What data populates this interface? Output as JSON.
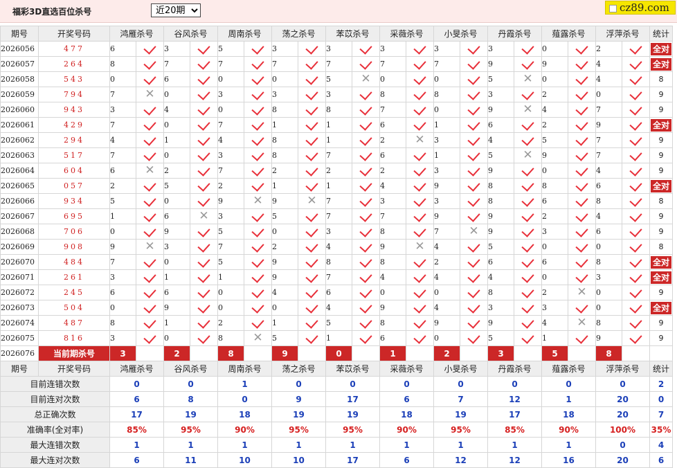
{
  "page": {
    "title": "福彩3D直选百位杀号",
    "period_select": "近20期",
    "logo_text": "cz89.com"
  },
  "header": {
    "period": "期号",
    "draw": "开奖号码",
    "experts": [
      "鸿雁杀号",
      "谷风杀号",
      "周南杀号",
      "荡之杀号",
      "苯苡杀号",
      "采薇杀号",
      "小旻杀号",
      "丹霞杀号",
      "薤露杀号",
      "浮萍杀号"
    ],
    "stat": "统计"
  },
  "rows": [
    {
      "period": "2026056",
      "draw": "477",
      "kills": [
        "6",
        "3",
        "5",
        "3",
        "3",
        "3",
        "3",
        "3",
        "0",
        "2"
      ],
      "hits": [
        "y",
        "y",
        "y",
        "y",
        "y",
        "y",
        "y",
        "y",
        "y",
        "y"
      ],
      "stat": "全对"
    },
    {
      "period": "2026057",
      "draw": "264",
      "kills": [
        "8",
        "7",
        "7",
        "7",
        "7",
        "7",
        "7",
        "9",
        "9",
        "4"
      ],
      "hits": [
        "y",
        "y",
        "y",
        "y",
        "y",
        "y",
        "y",
        "y",
        "y",
        "y"
      ],
      "stat": "全对"
    },
    {
      "period": "2026058",
      "draw": "543",
      "kills": [
        "0",
        "6",
        "0",
        "0",
        "5",
        "0",
        "0",
        "5",
        "0",
        "4"
      ],
      "hits": [
        "y",
        "y",
        "y",
        "y",
        "n",
        "y",
        "y",
        "n",
        "y",
        "y"
      ],
      "stat": "8"
    },
    {
      "period": "2026059",
      "draw": "794",
      "kills": [
        "7",
        "0",
        "3",
        "3",
        "3",
        "8",
        "8",
        "3",
        "2",
        "0"
      ],
      "hits": [
        "n",
        "y",
        "y",
        "y",
        "y",
        "y",
        "y",
        "y",
        "y",
        "y"
      ],
      "stat": "9"
    },
    {
      "period": "2026060",
      "draw": "943",
      "kills": [
        "3",
        "4",
        "0",
        "8",
        "8",
        "7",
        "0",
        "9",
        "4",
        "7"
      ],
      "hits": [
        "y",
        "y",
        "y",
        "y",
        "y",
        "y",
        "y",
        "n",
        "y",
        "y"
      ],
      "stat": "9"
    },
    {
      "period": "2026061",
      "draw": "429",
      "kills": [
        "7",
        "0",
        "7",
        "1",
        "1",
        "6",
        "1",
        "6",
        "2",
        "9"
      ],
      "hits": [
        "y",
        "y",
        "y",
        "y",
        "y",
        "y",
        "y",
        "y",
        "y",
        "y"
      ],
      "stat": "全对"
    },
    {
      "period": "2026062",
      "draw": "294",
      "kills": [
        "4",
        "1",
        "4",
        "8",
        "1",
        "2",
        "3",
        "4",
        "5",
        "7"
      ],
      "hits": [
        "y",
        "y",
        "y",
        "y",
        "y",
        "n",
        "y",
        "y",
        "y",
        "y"
      ],
      "stat": "9"
    },
    {
      "period": "2026063",
      "draw": "517",
      "kills": [
        "7",
        "0",
        "3",
        "8",
        "7",
        "6",
        "1",
        "5",
        "9",
        "7"
      ],
      "hits": [
        "y",
        "y",
        "y",
        "y",
        "y",
        "y",
        "y",
        "n",
        "y",
        "y"
      ],
      "stat": "9"
    },
    {
      "period": "2026064",
      "draw": "604",
      "kills": [
        "6",
        "2",
        "7",
        "2",
        "2",
        "2",
        "3",
        "9",
        "0",
        "4"
      ],
      "hits": [
        "n",
        "y",
        "y",
        "y",
        "y",
        "y",
        "y",
        "y",
        "y",
        "y"
      ],
      "stat": "9"
    },
    {
      "period": "2026065",
      "draw": "057",
      "kills": [
        "2",
        "5",
        "2",
        "1",
        "1",
        "4",
        "9",
        "8",
        "8",
        "6"
      ],
      "hits": [
        "y",
        "y",
        "y",
        "y",
        "y",
        "y",
        "y",
        "y",
        "y",
        "y"
      ],
      "stat": "全对"
    },
    {
      "period": "2026066",
      "draw": "934",
      "kills": [
        "5",
        "0",
        "9",
        "9",
        "7",
        "3",
        "3",
        "8",
        "6",
        "8"
      ],
      "hits": [
        "y",
        "y",
        "n",
        "n",
        "y",
        "y",
        "y",
        "y",
        "y",
        "y"
      ],
      "stat": "8"
    },
    {
      "period": "2026067",
      "draw": "695",
      "kills": [
        "1",
        "6",
        "3",
        "5",
        "7",
        "7",
        "9",
        "9",
        "2",
        "4"
      ],
      "hits": [
        "y",
        "n",
        "y",
        "y",
        "y",
        "y",
        "y",
        "y",
        "y",
        "y"
      ],
      "stat": "9"
    },
    {
      "period": "2026068",
      "draw": "706",
      "kills": [
        "0",
        "9",
        "5",
        "0",
        "3",
        "8",
        "7",
        "9",
        "3",
        "6"
      ],
      "hits": [
        "y",
        "y",
        "y",
        "y",
        "y",
        "y",
        "n",
        "y",
        "y",
        "y"
      ],
      "stat": "9"
    },
    {
      "period": "2026069",
      "draw": "908",
      "kills": [
        "9",
        "3",
        "7",
        "2",
        "4",
        "9",
        "4",
        "5",
        "0",
        "0"
      ],
      "hits": [
        "n",
        "y",
        "y",
        "y",
        "y",
        "n",
        "y",
        "y",
        "y",
        "y"
      ],
      "stat": "8"
    },
    {
      "period": "2026070",
      "draw": "484",
      "kills": [
        "7",
        "0",
        "5",
        "9",
        "8",
        "8",
        "2",
        "6",
        "6",
        "8"
      ],
      "hits": [
        "y",
        "y",
        "y",
        "y",
        "y",
        "y",
        "y",
        "y",
        "y",
        "y"
      ],
      "stat": "全对"
    },
    {
      "period": "2026071",
      "draw": "261",
      "kills": [
        "3",
        "1",
        "1",
        "9",
        "7",
        "4",
        "4",
        "4",
        "0",
        "3"
      ],
      "hits": [
        "y",
        "y",
        "y",
        "y",
        "y",
        "y",
        "y",
        "y",
        "y",
        "y"
      ],
      "stat": "全对"
    },
    {
      "period": "2026072",
      "draw": "245",
      "kills": [
        "6",
        "6",
        "0",
        "4",
        "6",
        "0",
        "0",
        "8",
        "2",
        "0"
      ],
      "hits": [
        "y",
        "y",
        "y",
        "y",
        "y",
        "y",
        "y",
        "y",
        "n",
        "y"
      ],
      "stat": "9"
    },
    {
      "period": "2026073",
      "draw": "504",
      "kills": [
        "0",
        "9",
        "0",
        "0",
        "4",
        "9",
        "4",
        "3",
        "3",
        "0"
      ],
      "hits": [
        "y",
        "y",
        "y",
        "y",
        "y",
        "y",
        "y",
        "y",
        "y",
        "y"
      ],
      "stat": "全对"
    },
    {
      "period": "2026074",
      "draw": "487",
      "kills": [
        "8",
        "1",
        "2",
        "1",
        "5",
        "8",
        "9",
        "9",
        "4",
        "8"
      ],
      "hits": [
        "y",
        "y",
        "y",
        "y",
        "y",
        "y",
        "y",
        "y",
        "n",
        "y"
      ],
      "stat": "9"
    },
    {
      "period": "2026075",
      "draw": "816",
      "kills": [
        "3",
        "0",
        "8",
        "5",
        "1",
        "6",
        "0",
        "5",
        "1",
        "9"
      ],
      "hits": [
        "y",
        "y",
        "n",
        "y",
        "y",
        "y",
        "y",
        "y",
        "y",
        "y"
      ],
      "stat": "9"
    }
  ],
  "current": {
    "period": "2026076",
    "label": "当前期杀号",
    "kills": [
      "3",
      "2",
      "8",
      "9",
      "0",
      "1",
      "2",
      "3",
      "5",
      "8"
    ]
  },
  "summary": {
    "labels": [
      "目前连错次数",
      "目前连对次数",
      "总正确次数",
      "准确率(全对率)",
      "最大连错次数",
      "最大连对次数"
    ],
    "values": [
      [
        "0",
        "0",
        "1",
        "0",
        "0",
        "0",
        "0",
        "0",
        "0",
        "0",
        "2"
      ],
      [
        "6",
        "8",
        "0",
        "9",
        "17",
        "6",
        "7",
        "12",
        "1",
        "20",
        "0"
      ],
      [
        "17",
        "19",
        "18",
        "19",
        "19",
        "18",
        "19",
        "17",
        "18",
        "20",
        "7"
      ],
      [
        "85%",
        "95%",
        "90%",
        "95%",
        "95%",
        "90%",
        "95%",
        "85%",
        "90%",
        "100%",
        "35%"
      ],
      [
        "1",
        "1",
        "1",
        "1",
        "1",
        "1",
        "1",
        "1",
        "1",
        "0",
        "4"
      ],
      [
        "6",
        "11",
        "10",
        "10",
        "17",
        "6",
        "12",
        "12",
        "16",
        "20",
        "6"
      ]
    ]
  },
  "colors": {
    "accent_red": "#cc2727",
    "tick_red": "#e8303a",
    "value_blue": "#1b3fb8",
    "header_gray": "#eeeeee"
  }
}
